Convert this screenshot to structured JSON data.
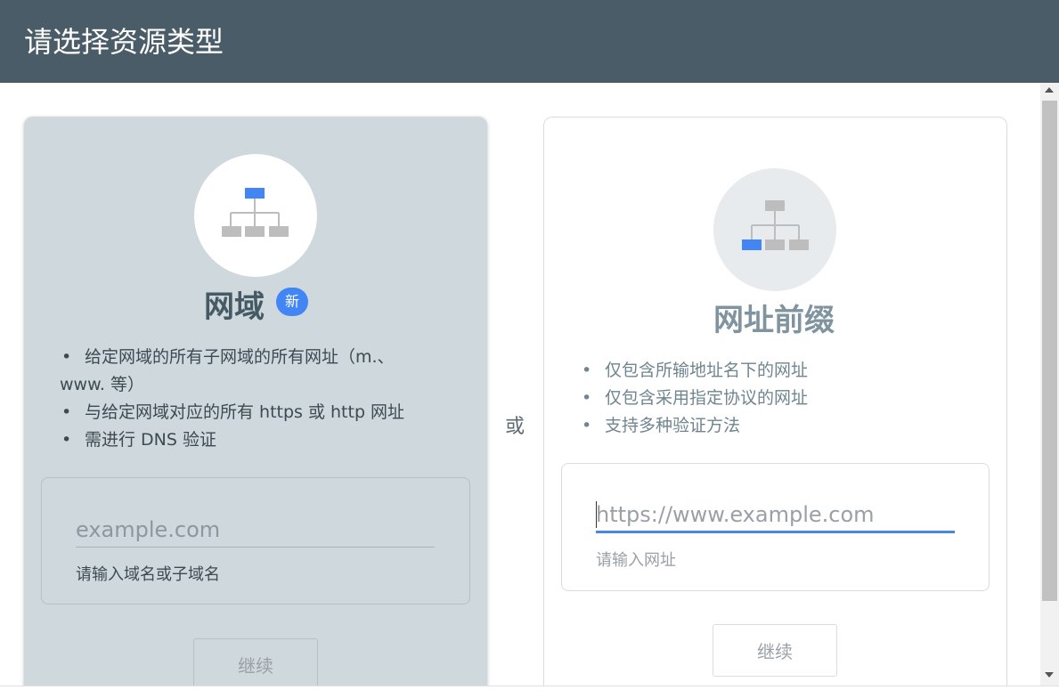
{
  "header": {
    "title": "请选择资源类型"
  },
  "separator": {
    "or_label": "或"
  },
  "domain_card": {
    "icon": "sitemap-icon-top-highlight",
    "title": "网域",
    "badge": "新",
    "bullets": [
      "给定网域的所有子网域的所有网址（m.、www. 等）",
      "与给定网域对应的所有 https 或 http 网址",
      "需进行 DNS 验证"
    ],
    "bullet_1_line1": "给定网域的所有子网域的所有网址（m.、",
    "bullet_1_line2": "www. 等）",
    "input_placeholder": "example.com",
    "input_value": "",
    "input_hint": "请输入域名或子域名",
    "continue_label": "继续"
  },
  "url_card": {
    "icon": "sitemap-icon-leaf-highlight",
    "title": "网址前缀",
    "bullets": [
      "仅包含所输地址名下的网址",
      "仅包含采用指定协议的网址",
      "支持多种验证方法"
    ],
    "input_placeholder": "https://www.example.com",
    "input_value": "",
    "input_hint": "请输入网址",
    "continue_label": "继续"
  },
  "colors": {
    "header_bg": "#4a5c67",
    "selected_card_bg": "#cfd8dd",
    "accent_blue": "#4285f4",
    "node_gray": "#bdbdbd"
  }
}
